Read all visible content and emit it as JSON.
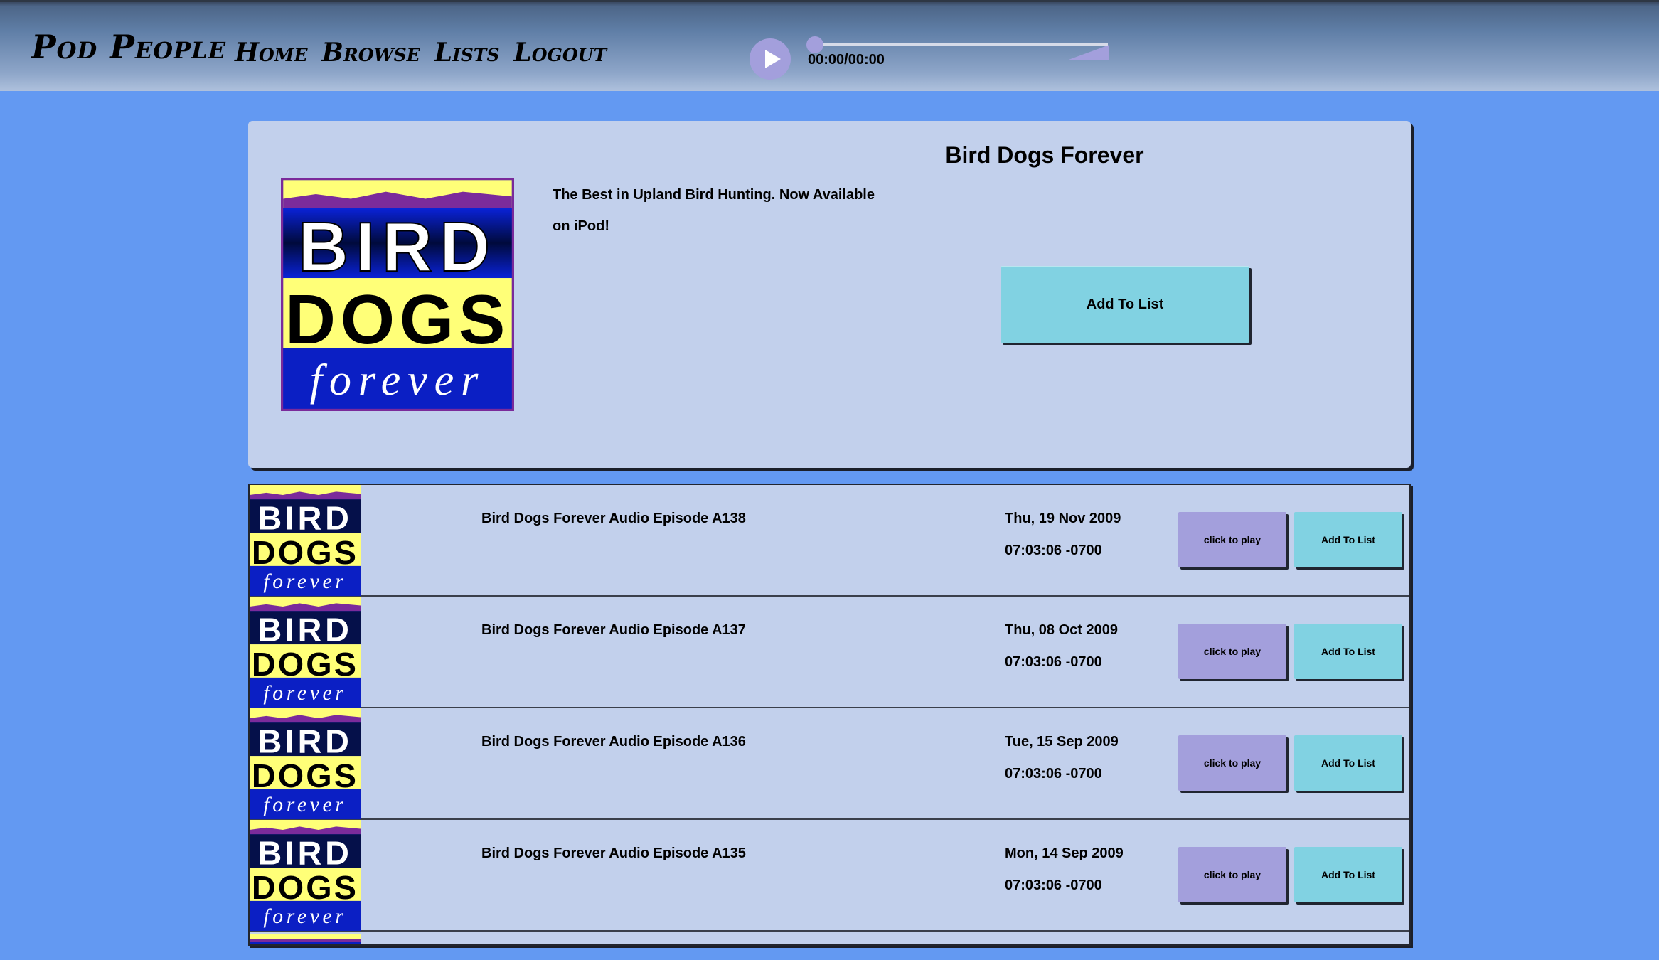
{
  "header": {
    "brand": "Pod People",
    "nav": [
      "Home",
      "Browse",
      "Lists",
      "Logout"
    ],
    "player": {
      "time": "00:00/00:00",
      "play_icon": "play-icon",
      "progress": 0,
      "volume": 1.0
    }
  },
  "podcast": {
    "title": "Bird Dogs Forever",
    "description": "The Best in Upland Bird Hunting. Now Available on iPod!",
    "add_to_list_label": "Add To List",
    "cover_art": {
      "line1": "BIRD",
      "line2": "DOGS",
      "line3": "forever"
    }
  },
  "episodes": [
    {
      "title": "Bird Dogs Forever Audio Episode A138",
      "date": "Thu, 19 Nov 2009",
      "time": "07:03:06 -0700",
      "play_label": "click to play",
      "add_label": "Add To List"
    },
    {
      "title": "Bird Dogs Forever Audio Episode A137",
      "date": "Thu, 08 Oct 2009",
      "time": "07:03:06 -0700",
      "play_label": "click to play",
      "add_label": "Add To List"
    },
    {
      "title": "Bird Dogs Forever Audio Episode A136",
      "date": "Tue, 15 Sep 2009",
      "time": "07:03:06 -0700",
      "play_label": "click to play",
      "add_label": "Add To List"
    },
    {
      "title": "Bird Dogs Forever Audio Episode A135",
      "date": "Mon, 14 Sep 2009",
      "time": "07:03:06 -0700",
      "play_label": "click to play",
      "add_label": "Add To List"
    }
  ],
  "colors": {
    "page_background": "#6399f2",
    "card_background": "#c2d0ec",
    "play_button": "#a39fdc",
    "add_button": "#81d2e2"
  }
}
